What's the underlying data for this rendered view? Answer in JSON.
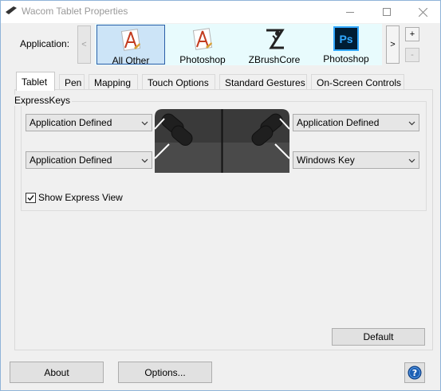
{
  "window": {
    "title": "Wacom Tablet Properties",
    "title_icon": "wacom-pen-icon"
  },
  "application": {
    "label": "Application:",
    "prev_label": "<",
    "next_label": ">",
    "add_label": "+",
    "remove_label": "-",
    "items": [
      {
        "label": "All Other",
        "icon": "all-other-app-icon",
        "selected": true
      },
      {
        "label": "Photoshop",
        "icon": "generic-app-icon",
        "selected": false
      },
      {
        "label": "ZBrushCore",
        "icon": "zbrush-icon",
        "selected": false
      },
      {
        "label": "Photoshop",
        "icon": "photoshop-icon",
        "selected": false,
        "icon_text": "Ps"
      }
    ]
  },
  "tabs": [
    {
      "label": "Tablet",
      "active": true
    },
    {
      "label": "Pen",
      "active": false
    },
    {
      "label": "Mapping",
      "active": false
    },
    {
      "label": "Touch Options",
      "active": false
    },
    {
      "label": "Standard Gestures",
      "active": false
    },
    {
      "label": "On-Screen Controls",
      "active": false
    }
  ],
  "expresskeys": {
    "group_title": "ExpressKeys",
    "left_top": "Application Defined",
    "left_bottom": "Application Defined",
    "right_top": "Application Defined",
    "right_bottom": "Windows Key"
  },
  "show_express_view": {
    "label": "Show Express View",
    "checked": true
  },
  "buttons": {
    "default": "Default",
    "about": "About",
    "options": "Options..."
  },
  "colors": {
    "accent": "#2b5fa8",
    "app_strip_bg": "#e8fbfd",
    "selected_bg": "#cce4f7",
    "photoshop_bg": "#001d34",
    "photoshop_fg": "#31a8ff",
    "help_icon": "#1c5fb4"
  }
}
